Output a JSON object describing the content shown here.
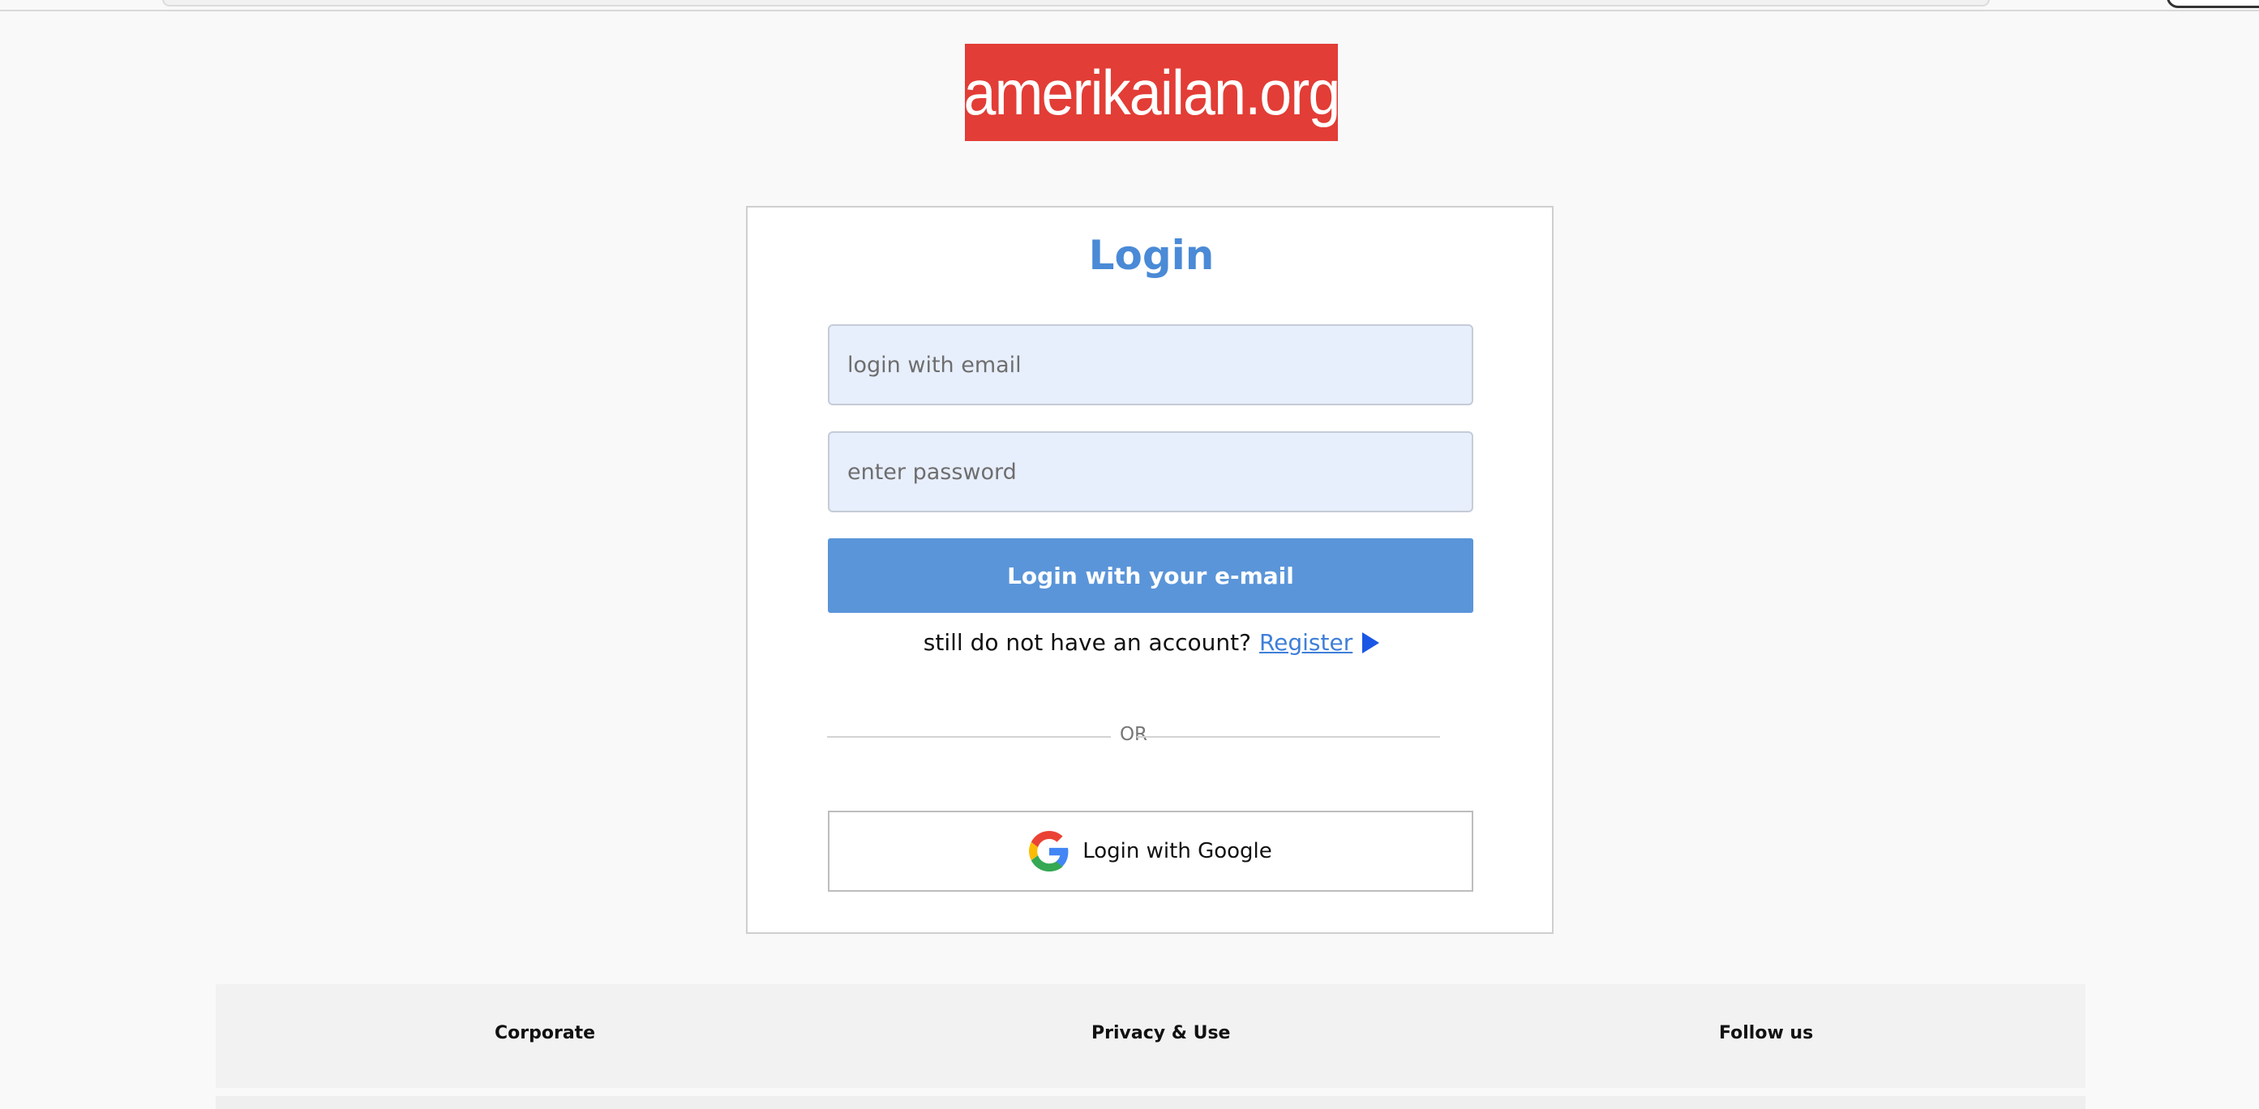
{
  "logo": {
    "text": "amerikailan.org",
    "bg_color": "#e23d36"
  },
  "login": {
    "title": "Login",
    "email_placeholder": "login with email",
    "password_placeholder": "enter password",
    "submit_label": "Login with your e-mail",
    "no_account_text": "still do not have an account?",
    "register_label": "Register",
    "or_text": "OR",
    "google_label": "Login with Google",
    "accent_color": "#4a8ad6",
    "button_color": "#5a95d9"
  },
  "footer": {
    "corporate": "Corporate",
    "privacy": "Privacy & Use",
    "follow": "Follow us"
  },
  "icons": {
    "register_arrow": "play-triangle-icon",
    "google": "google-g-icon"
  }
}
